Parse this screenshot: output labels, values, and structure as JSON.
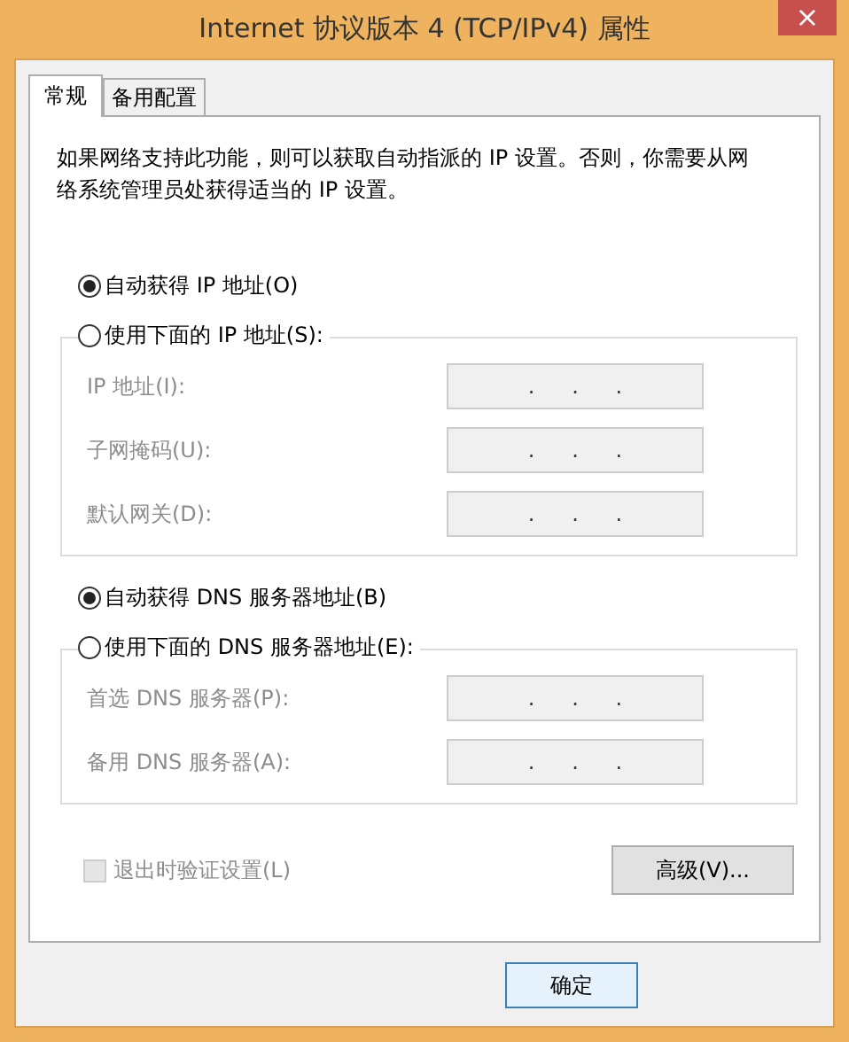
{
  "window": {
    "title": "Internet 协议版本 4 (TCP/IPv4) 属性",
    "close_icon": "×"
  },
  "tabs": [
    {
      "label": "常规",
      "selected": true
    },
    {
      "label": "备用配置",
      "selected": false
    }
  ],
  "description": "如果网络支持此功能，则可以获取自动指派的 IP 设置。否则，你需要从网络系统管理员处获得适当的 IP 设置。",
  "sections": [
    {
      "auto_option": {
        "label": "自动获得 IP 地址(O)",
        "selected": true
      },
      "manual_option": {
        "label": "使用下面的 IP 地址(S):",
        "selected": false
      },
      "fields": [
        {
          "label": "IP 地址(I):",
          "disabled": true,
          "separators": [
            ".",
            ".",
            "."
          ]
        },
        {
          "label": "子网掩码(U):",
          "disabled": true,
          "separators": [
            ".",
            ".",
            "."
          ]
        },
        {
          "label": "默认网关(D):",
          "disabled": true,
          "separators": [
            ".",
            ".",
            "."
          ]
        }
      ]
    },
    {
      "auto_option": {
        "label": "自动获得 DNS 服务器地址(B)",
        "selected": true
      },
      "manual_option": {
        "label": "使用下面的 DNS 服务器地址(E):",
        "selected": false
      },
      "fields": [
        {
          "label": "首选 DNS 服务器(P):",
          "disabled": true,
          "separators": [
            ".",
            ".",
            "."
          ]
        },
        {
          "label": "备用 DNS 服务器(A):",
          "disabled": true,
          "separators": [
            ".",
            ".",
            "."
          ]
        }
      ]
    }
  ],
  "validate_checkbox": {
    "label": "退出时验证设置(L)",
    "checked": false,
    "disabled": true
  },
  "advanced_button": "高级(V)...",
  "buttons": [
    "确定"
  ]
}
